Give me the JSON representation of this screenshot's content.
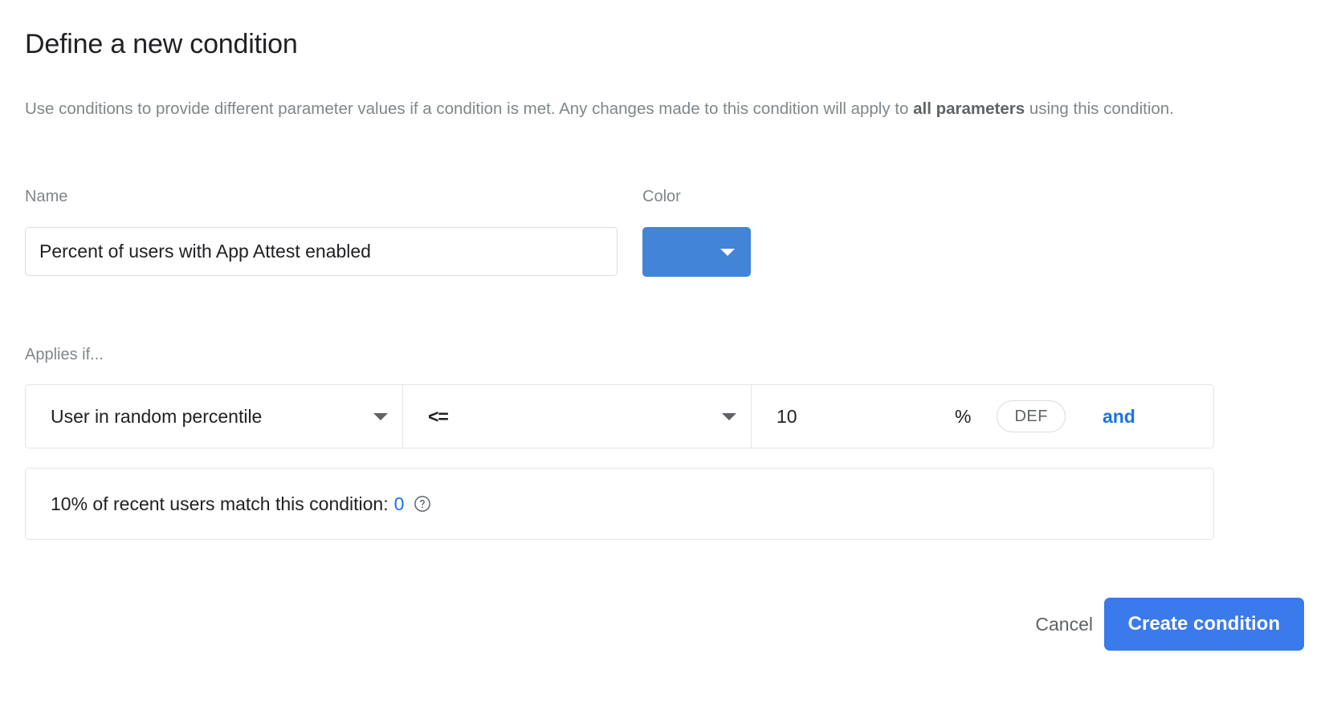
{
  "dialog": {
    "title": "Define a new condition",
    "description_part1": "Use conditions to provide different parameter values if a condition is met. Any changes made to this condition will apply to ",
    "description_bold": "all parameters",
    "description_part2": " using this condition."
  },
  "name_field": {
    "label": "Name",
    "value": "Percent of users with App Attest enabled",
    "placeholder": "Name"
  },
  "color_field": {
    "label": "Color",
    "selected_color": "#4285d6",
    "caret_icon": "chevron-down-icon"
  },
  "applies": {
    "label": "Applies if...",
    "attribute": "User in random percentile",
    "operator": "<=",
    "value": "10",
    "value_placeholder": "",
    "unit": "%",
    "seed_chip": "DEF",
    "and_link": "and",
    "attribute_caret_icon": "chevron-down-icon",
    "operator_caret_icon": "chevron-down-icon"
  },
  "match_summary": {
    "text": "10% of recent users match this condition:",
    "count": "0",
    "help_icon": "help-circle-icon"
  },
  "footer": {
    "cancel_label": "Cancel",
    "create_label": "Create condition"
  },
  "colors": {
    "accent_blue": "#1a73e8",
    "primary_button": "#3a7aea",
    "swatch_blue": "#4285d6",
    "muted_text": "#80868b",
    "body_text": "#202124",
    "border": "#e3e5e8"
  }
}
